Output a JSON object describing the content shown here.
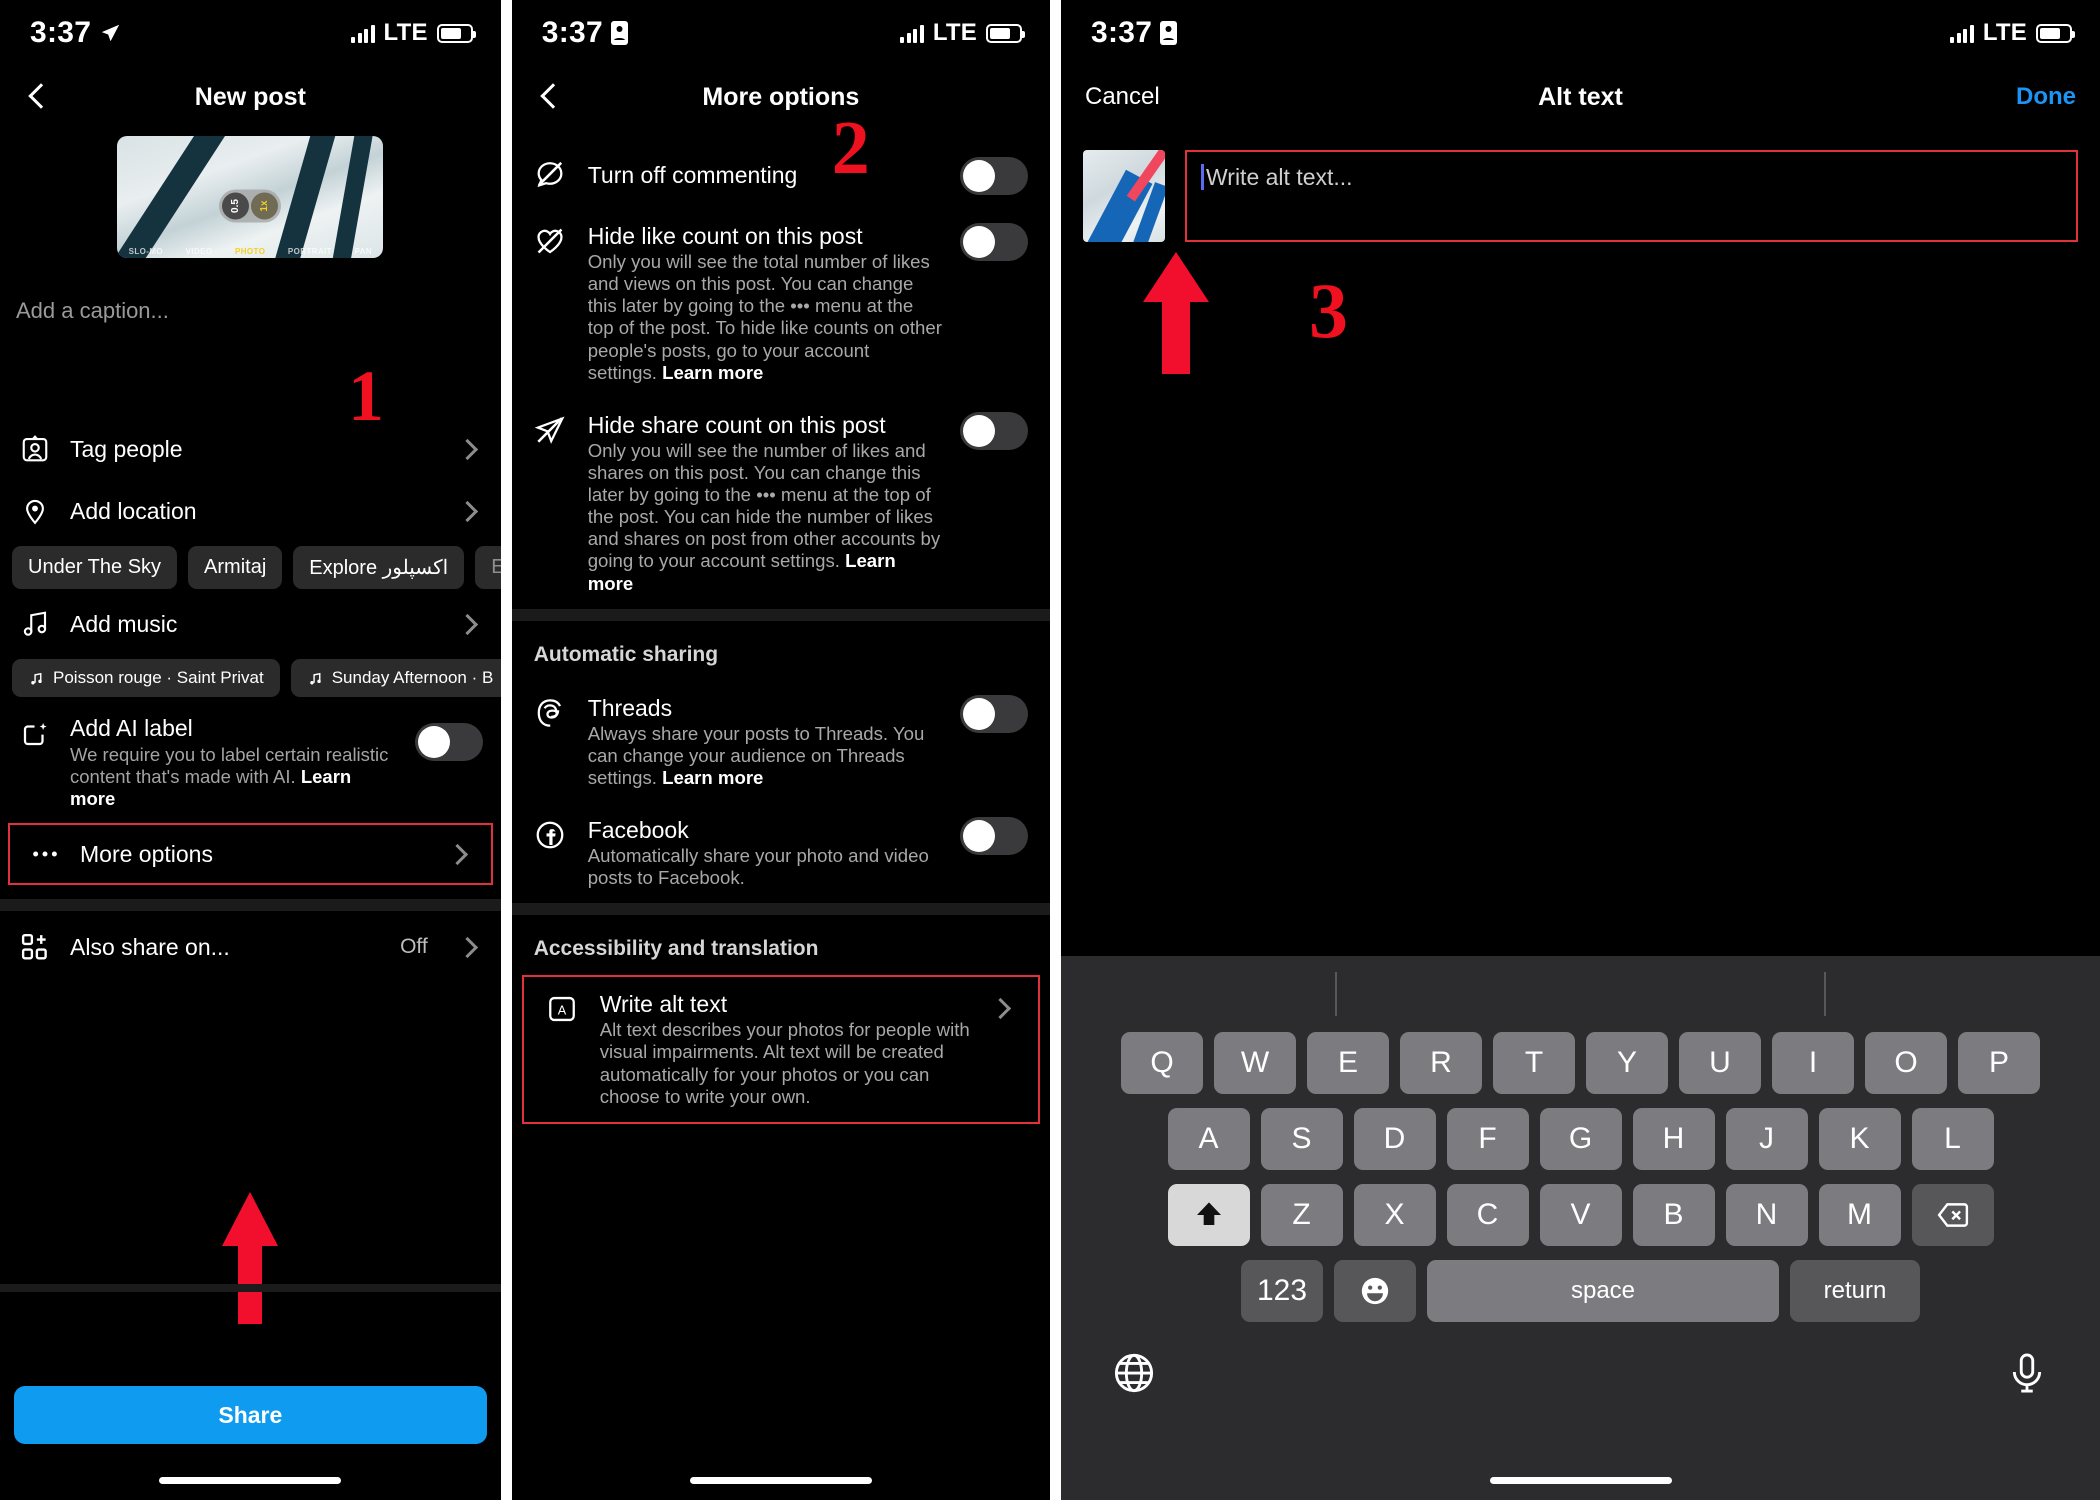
{
  "status_bar": {
    "time": "3:37",
    "network": "LTE"
  },
  "panel1": {
    "nav_title": "New post",
    "caption_placeholder": "Add a caption...",
    "thumb_zoom": {
      "wide": "0.5",
      "main": "1x"
    },
    "thumb_modes": [
      "SLO-MO",
      "VIDEO",
      "PHOTO",
      "PORTRAIT",
      "PAN"
    ],
    "rows": {
      "tag_people": "Tag people",
      "add_location": "Add location",
      "add_music": "Add music",
      "ai_label_title": "Add AI label",
      "ai_label_desc": "We require you to label certain realistic content that's made with AI.",
      "ai_label_link": "Learn more",
      "more_options": "More options",
      "also_share_on": "Also share on...",
      "also_share_value": "Off"
    },
    "location_chips": [
      "Under The Sky",
      "Armitaj",
      "Explore اكسپلور",
      "Explore -"
    ],
    "music_chips": [
      "Poisson rouge · Saint Privat",
      "Sunday Afternoon · B"
    ],
    "share_button": "Share",
    "marker": "1"
  },
  "panel2": {
    "nav_title": "More options",
    "marker": "2",
    "items": [
      {
        "title": "Turn off commenting",
        "desc": "",
        "link": "",
        "toggle": "off"
      },
      {
        "title": "Hide like count on this post",
        "desc": "Only you will see the total number of likes and views on this post. You can change this later by going to the ••• menu at the top of the post. To hide like counts on other people's posts, go to your account settings.",
        "link": "Learn more",
        "toggle": "off"
      },
      {
        "title": "Hide share count on this post",
        "desc": "Only you will see the number of likes and shares on this post. You can change this later by going to the ••• menu at the top of the post. You can hide the number of likes and shares on post from other accounts by going to your account settings.",
        "link": "Learn more",
        "toggle": "off"
      }
    ],
    "section_automatic_sharing": "Automatic sharing",
    "auto_items": [
      {
        "title": "Threads",
        "desc": "Always share your posts to Threads. You can change your audience on Threads settings.",
        "link": "Learn more",
        "toggle": "off"
      },
      {
        "title": "Facebook",
        "desc": "Automatically share your photo and video posts to Facebook.",
        "link": "",
        "toggle": "off"
      }
    ],
    "section_accessibility": "Accessibility and translation",
    "alt_text_item": {
      "title": "Write alt text",
      "desc": "Alt text describes your photos for people with visual impairments. Alt text will be created automatically for your photos or you can choose to write your own."
    }
  },
  "panel3": {
    "cancel_label": "Cancel",
    "nav_title": "Alt text",
    "done_label": "Done",
    "alt_placeholder": "Write alt text...",
    "marker": "3",
    "keyboard": {
      "row1": [
        "Q",
        "W",
        "E",
        "R",
        "T",
        "Y",
        "U",
        "I",
        "O",
        "P"
      ],
      "row2": [
        "A",
        "S",
        "D",
        "F",
        "G",
        "H",
        "J",
        "K",
        "L"
      ],
      "row3": [
        "Z",
        "X",
        "C",
        "V",
        "B",
        "N",
        "M"
      ],
      "numbers_key": "123",
      "space_key": "space",
      "return_key": "return"
    }
  }
}
